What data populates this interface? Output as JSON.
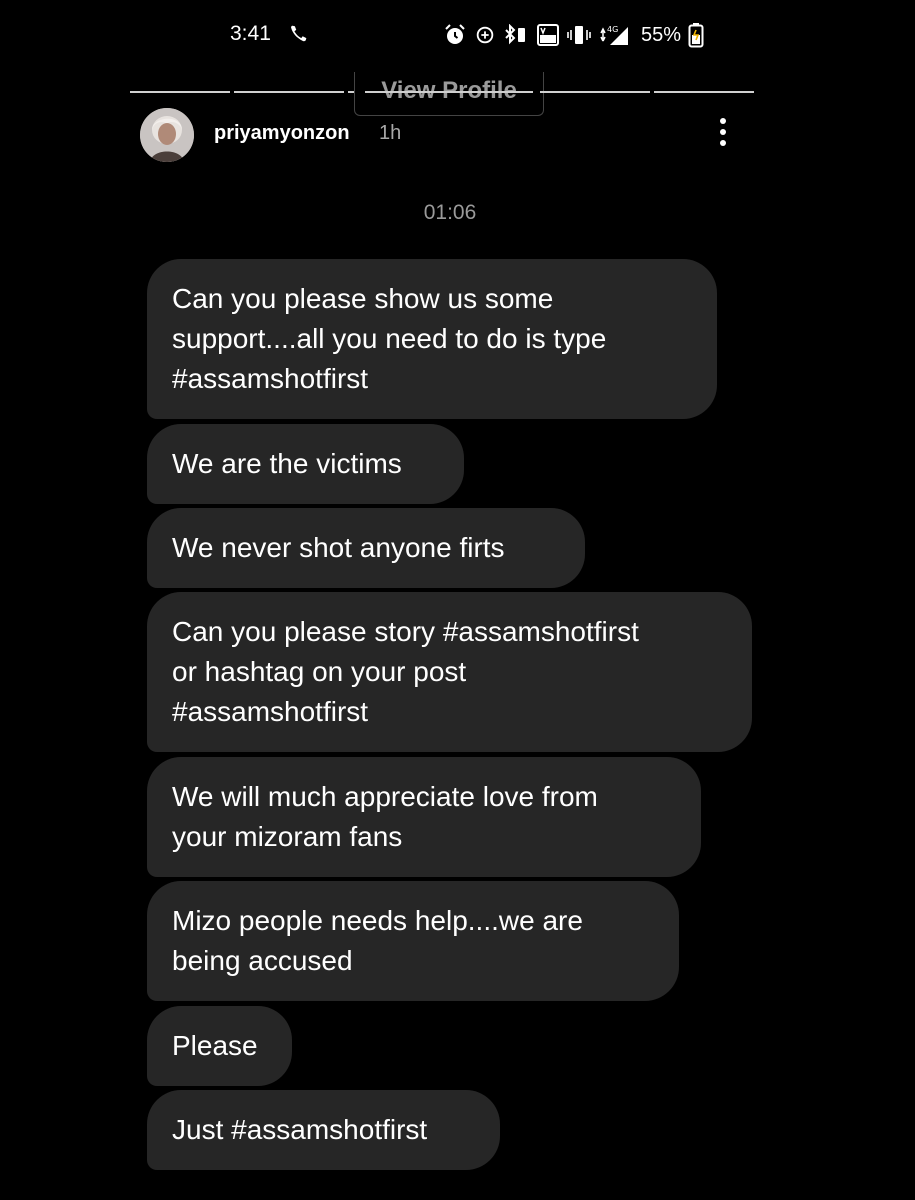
{
  "status_bar": {
    "time": "3:41",
    "battery": "55%"
  },
  "profile_link": "View Profile",
  "header": {
    "username": "priyamyonzon",
    "time_ago": "1h"
  },
  "timestamp": "01:06",
  "messages": [
    {
      "lines": [
        "Can you please show us some",
        "support....all you need to do is type",
        "#assamshotfirst"
      ]
    },
    {
      "lines": [
        "We are the victims"
      ]
    },
    {
      "lines": [
        "We never shot anyone firts"
      ]
    },
    {
      "lines": [
        "Can you please story #assamshotfirst",
        "or hashtag on your post",
        "#assamshotfirst"
      ]
    },
    {
      "lines": [
        "We will much appreciate love from",
        "your mizoram fans"
      ]
    },
    {
      "lines": [
        "Mizo people needs help....we are",
        "being accused"
      ]
    },
    {
      "lines": [
        "Please"
      ]
    },
    {
      "lines": [
        "Just #assamshotfirst"
      ]
    }
  ],
  "colors": {
    "background": "#000000",
    "bubble": "#262626",
    "secondary_text": "#a8a8a8"
  }
}
